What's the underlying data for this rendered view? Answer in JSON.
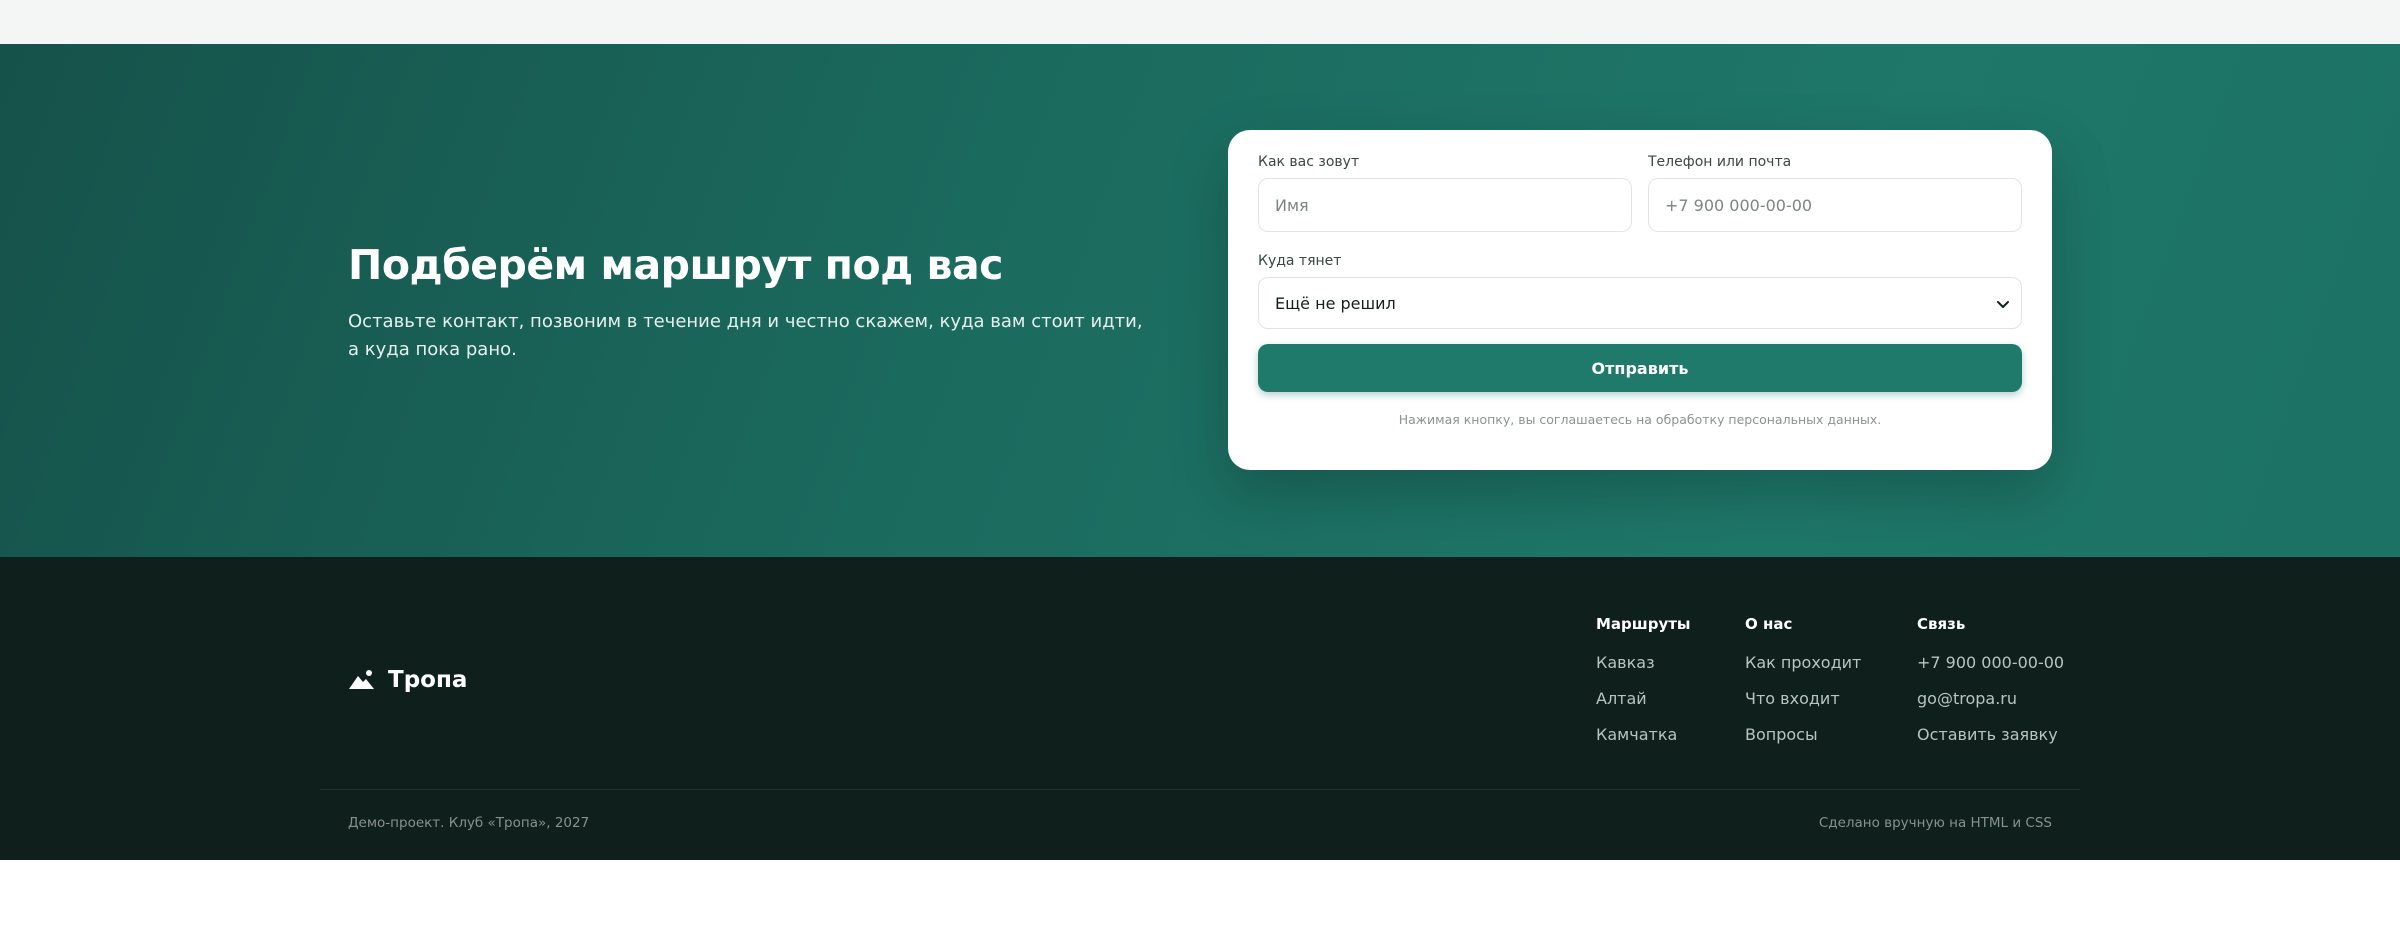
{
  "cta": {
    "title": "Подберём маршрут под вас",
    "subtitle": "Оставьте контакт, позвоним в течение дня и честно скажем, куда вам стоит идти, а куда пока рано."
  },
  "form": {
    "name_label": "Как вас зовут",
    "name_placeholder": "Имя",
    "contact_label": "Телефон или почта",
    "contact_placeholder": "+7 900 000-00-00",
    "destination_label": "Куда тянет",
    "destination_value": "Ещё не решил",
    "submit_label": "Отправить",
    "consent": "Нажимая кнопку, вы соглашаетесь на обработку персональных данных."
  },
  "footer": {
    "brand": "Тропа",
    "columns": [
      {
        "title": "Маршруты",
        "links": [
          "Кавказ",
          "Алтай",
          "Камчатка"
        ]
      },
      {
        "title": "О нас",
        "links": [
          "Как проходит",
          "Что входит",
          "Вопросы"
        ]
      },
      {
        "title": "Связь",
        "links": [
          "+7 900 000-00-00",
          "go@tropa.ru",
          "Оставить заявку"
        ]
      }
    ],
    "copyright": "Демо-проект. Клуб «Тропа», 2027",
    "made_with": "Сделано вручную на HTML и CSS"
  },
  "icons": {
    "logo": "mountain-icon",
    "select_arrow": "chevron-down-icon"
  },
  "colors": {
    "accent": "#1f7a6b",
    "footer_bg": "#0f1f1b"
  }
}
